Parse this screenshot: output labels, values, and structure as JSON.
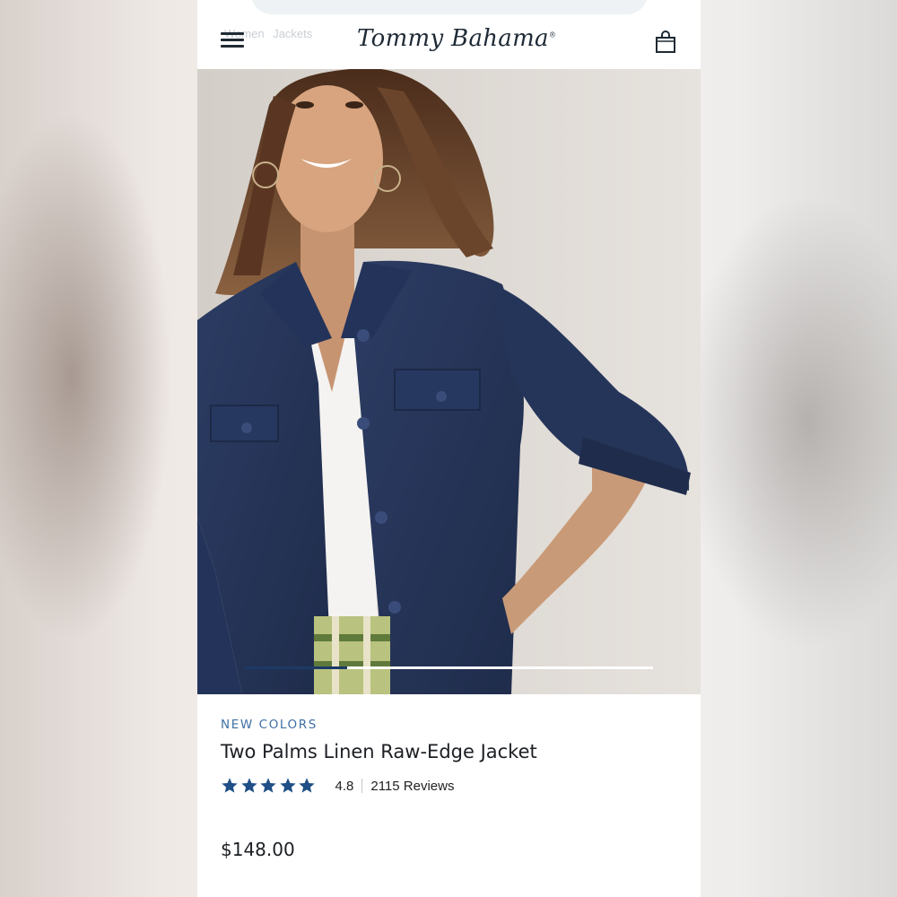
{
  "breadcrumb": [
    "Women",
    "Jackets"
  ],
  "brand": {
    "logo_text": "Tommy Bahama",
    "mark": "®"
  },
  "icons": {
    "menu": "hamburger-menu-icon",
    "bag": "shopping-bag-icon",
    "star": "star-icon"
  },
  "hero": {
    "image_alt": "Model wearing navy linen jacket over white tee",
    "carousel_progress": 0.25
  },
  "product": {
    "badge": "NEW COLORS",
    "title": "Two Palms Linen Raw-Edge Jacket",
    "rating": {
      "stars": 5,
      "value": "4.8",
      "reviews": "2115 Reviews"
    },
    "price": "$148.00"
  },
  "colors": {
    "accent": "#3f6fa3",
    "star": "#1f4f86",
    "jacket": "#27365a",
    "carousel_fill": "#1d3a66"
  }
}
